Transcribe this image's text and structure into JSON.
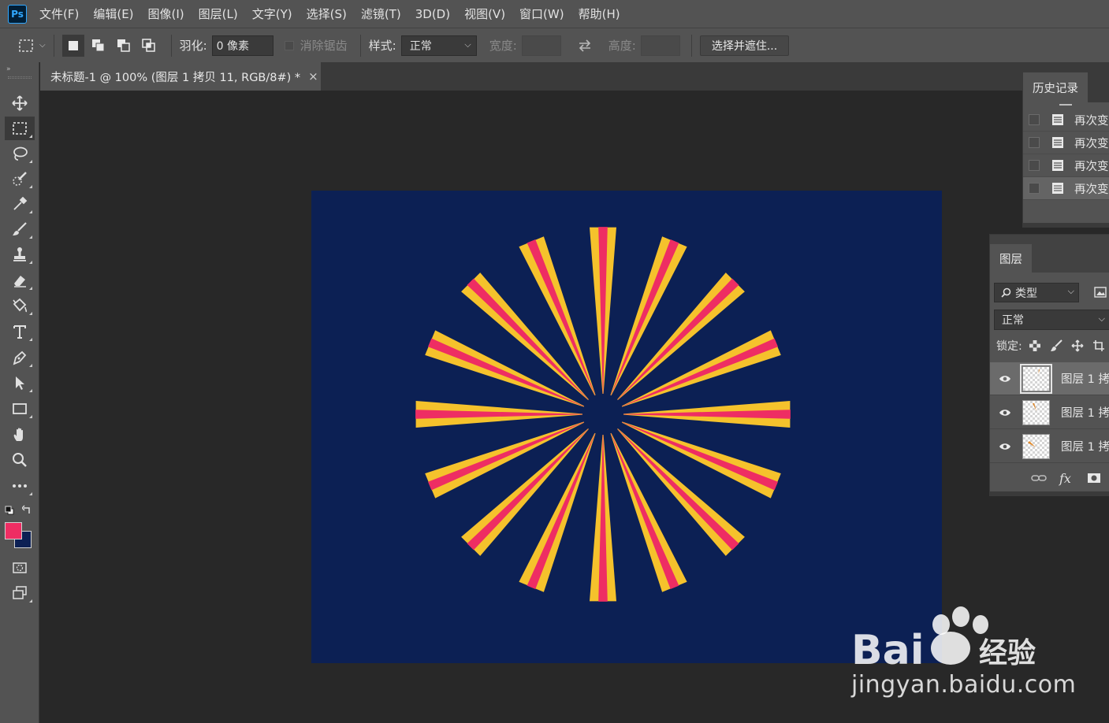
{
  "app": {
    "logo_text": "Ps",
    "menu": [
      "文件(F)",
      "编辑(E)",
      "图像(I)",
      "图层(L)",
      "文字(Y)",
      "选择(S)",
      "滤镜(T)",
      "3D(D)",
      "视图(V)",
      "窗口(W)",
      "帮助(H)"
    ]
  },
  "options": {
    "feather_label": "羽化:",
    "feather_value": "0 像素",
    "antialias_label": "消除锯齿",
    "style_label": "样式:",
    "style_value": "正常",
    "width_label": "宽度:",
    "height_label": "高度:",
    "select_mask_button": "选择并遮住..."
  },
  "document": {
    "tab_title": "未标题-1 @ 100% (图层 1 拷贝 11, RGB/8#) *",
    "close_glyph": "×",
    "background_color": "#0c2054",
    "ray_outer_color": "#f5c22c",
    "ray_inner_color": "#ee2d63",
    "ray_count": 16
  },
  "colors": {
    "foreground": "#ee2d63",
    "background": "#0c2054"
  },
  "history": {
    "tab_label": "历史记录",
    "items": [
      {
        "label": "再次变"
      },
      {
        "label": "再次变"
      },
      {
        "label": "再次变"
      },
      {
        "label": "再次变"
      }
    ]
  },
  "layers": {
    "tab_label": "图层",
    "filter_label": "类型",
    "blend_mode": "正常",
    "lock_label": "锁定:",
    "items": [
      {
        "name": "图层 1 拷"
      },
      {
        "name": "图层 1 拷"
      },
      {
        "name": "图层 1 拷"
      }
    ],
    "fx_label": "fx"
  },
  "watermark": {
    "brand": "Bai",
    "brand_suffix": "经验",
    "url": "jingyan.baidu.com"
  }
}
